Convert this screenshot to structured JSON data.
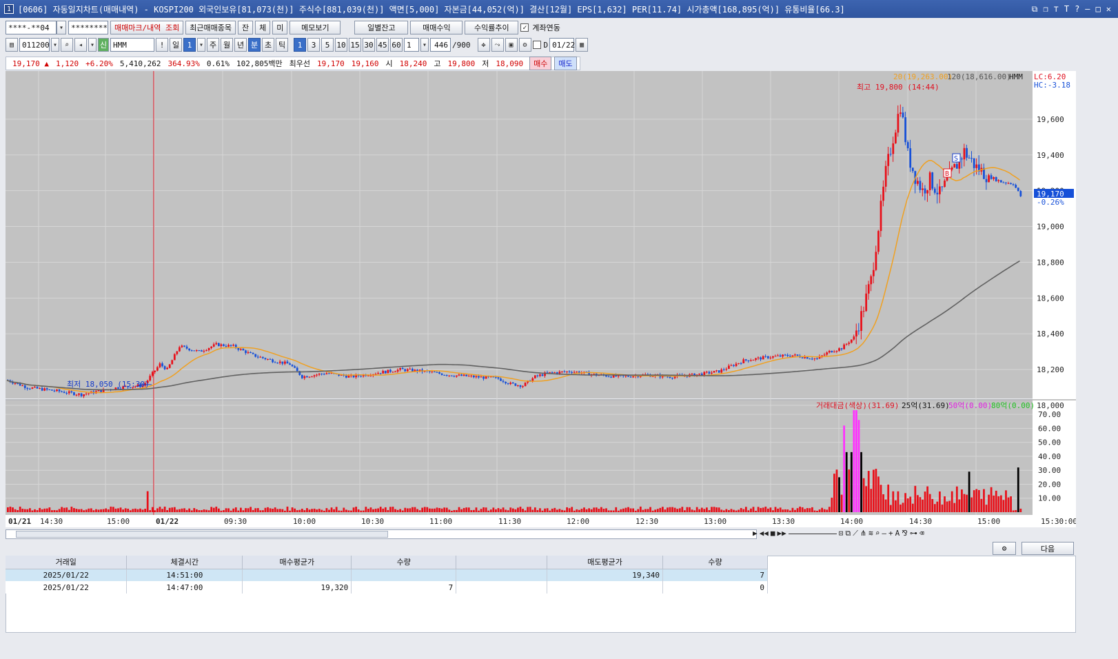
{
  "window": {
    "title": "[0606] 자동일지차트(매매내역) - KOSPI200 외국인보유[81,073(천)] 주식수[881,039(천)] 액면[5,000] 자본금[44,052(억)] 결산[12월] EPS[1,632] PER[11.74] 시가총액[168,895(억)] 유통비율[66.3]",
    "app_icon": "1"
  },
  "toolbar1": {
    "account": "****-**04",
    "password": "********",
    "mark_view_button": "매매마크/내역 조회",
    "recent_button": "최근매매종목",
    "btn_jan": "잔",
    "btn_che": "체",
    "btn_mi": "미",
    "memo_button": "메모보기",
    "daily_balance_button": "일별잔고",
    "trade_profit_button": "매매수익",
    "return_trend_button": "수익률추이",
    "account_link_label": "계좌연동",
    "account_link_checked": true
  },
  "toolbar2": {
    "code": "011200",
    "name": "HMM",
    "period_value": "1",
    "periods": [
      "일",
      "주",
      "월",
      "년",
      "분",
      "초",
      "틱"
    ],
    "minute_options": [
      "1",
      "3",
      "5",
      "10",
      "15",
      "30",
      "45",
      "60"
    ],
    "interval": "1",
    "count": "446",
    "count_max": "/900",
    "date_label": "D",
    "date": "01/22",
    "excl_label": "!",
    "sin_label": "신"
  },
  "quote": {
    "price": "19,170",
    "change": "1,120",
    "change_pct": "+6.20%",
    "volume": "5,410,262",
    "vol_ratio": "364.93%",
    "turnover": "0.61%",
    "amount": "102,805백만",
    "best_label": "최우선",
    "best_ask": "19,170",
    "best_bid": "19,160",
    "open_label": "시",
    "open": "18,240",
    "high_label": "고",
    "high": "19,800",
    "low_label": "저",
    "low": "18,090",
    "buy_button": "매수",
    "sell_button": "매도"
  },
  "chart_data": {
    "type": "candlestick",
    "symbol": "HMM",
    "timeframe": "1분",
    "ylim": [
      18000,
      19800
    ],
    "y_ticks": [
      "19,600",
      "19,400",
      "19,200",
      "19,000",
      "18,800",
      "18,600",
      "18,400",
      "18,200",
      "18,000"
    ],
    "x_ticks": [
      "01/21",
      "14:30",
      "15:00",
      "01/22",
      "09:30",
      "10:00",
      "10:30",
      "11:00",
      "11:30",
      "12:00",
      "12:30",
      "13:00",
      "13:30",
      "14:00",
      "14:30",
      "15:00",
      "15:30:00"
    ],
    "ma_legend": {
      "ma20": "20(19,263.00)",
      "ma120": "120(18,616.00)",
      "symbol": "HMM"
    },
    "lc_label": "LC:6.20",
    "hc_label": "HC:-3.18",
    "high_label": "최고 19,800 (14:44)",
    "low_label": "최저 18,050 (15:30)",
    "last_price": "19,170",
    "last_change": "-0.26%",
    "marks": [
      {
        "type": "B",
        "label": "B",
        "price": 19270
      },
      {
        "type": "S",
        "label": "S",
        "price": 19340
      }
    ],
    "price_anchors": [
      [
        0,
        18140
      ],
      [
        8,
        18100
      ],
      [
        20,
        18080
      ],
      [
        30,
        18060
      ],
      [
        45,
        18100
      ],
      [
        55,
        18110
      ],
      [
        57,
        18140
      ],
      [
        58,
        18160
      ],
      [
        62,
        18230
      ],
      [
        65,
        18200
      ],
      [
        70,
        18330
      ],
      [
        78,
        18300
      ],
      [
        85,
        18340
      ],
      [
        92,
        18330
      ],
      [
        100,
        18280
      ],
      [
        108,
        18250
      ],
      [
        115,
        18230
      ],
      [
        120,
        18160
      ],
      [
        130,
        18180
      ],
      [
        140,
        18160
      ],
      [
        150,
        18180
      ],
      [
        160,
        18200
      ],
      [
        170,
        18190
      ],
      [
        180,
        18170
      ],
      [
        190,
        18160
      ],
      [
        200,
        18150
      ],
      [
        205,
        18120
      ],
      [
        210,
        18110
      ],
      [
        215,
        18160
      ],
      [
        220,
        18180
      ],
      [
        230,
        18190
      ],
      [
        240,
        18170
      ],
      [
        250,
        18160
      ],
      [
        260,
        18170
      ],
      [
        270,
        18160
      ],
      [
        280,
        18170
      ],
      [
        290,
        18190
      ],
      [
        300,
        18250
      ],
      [
        310,
        18270
      ],
      [
        320,
        18280
      ],
      [
        330,
        18260
      ],
      [
        335,
        18300
      ],
      [
        340,
        18320
      ],
      [
        345,
        18380
      ],
      [
        348,
        18500
      ],
      [
        352,
        18700
      ],
      [
        355,
        19000
      ],
      [
        358,
        19300
      ],
      [
        361,
        19500
      ],
      [
        364,
        19680
      ],
      [
        367,
        19400
      ],
      [
        370,
        19280
      ],
      [
        373,
        19200
      ],
      [
        376,
        19260
      ],
      [
        380,
        19180
      ],
      [
        385,
        19300
      ],
      [
        390,
        19420
      ],
      [
        395,
        19330
      ],
      [
        400,
        19280
      ],
      [
        405,
        19250
      ],
      [
        410,
        19240
      ],
      [
        413,
        19170
      ]
    ],
    "ma20_end": 19263,
    "ma120_end": 18616,
    "volume": {
      "legend": "거래대금(색상)(31.69)",
      "legend_25": "25억(31.69)",
      "legend_50": "50억(0.00)",
      "legend_80": "80억(0.00)",
      "ylim": [
        0,
        75
      ],
      "y_ticks": [
        "70.00",
        "60.00",
        "50.00",
        "40.00",
        "30.00",
        "20.00",
        "10.00"
      ]
    }
  },
  "bottom_toolbar": {
    "next_button": "다음"
  },
  "trade_table": {
    "columns": [
      "거래일",
      "체결시간",
      "매수평균가",
      "수량",
      "",
      "매도평균가",
      "수량"
    ],
    "rows": [
      [
        "2025/01/22",
        "14:51:00",
        "",
        "",
        "",
        "19,340",
        "7"
      ],
      [
        "2025/01/22",
        "14:47:00",
        "19,320",
        "7",
        "",
        "",
        "0"
      ]
    ]
  },
  "colors": {
    "up": "#e8101a",
    "down": "#1650d8",
    "ma20": "#f0a020",
    "ma120": "#606060",
    "chart_bg": "#c2c2c2",
    "magenta": "#ff30ff"
  }
}
